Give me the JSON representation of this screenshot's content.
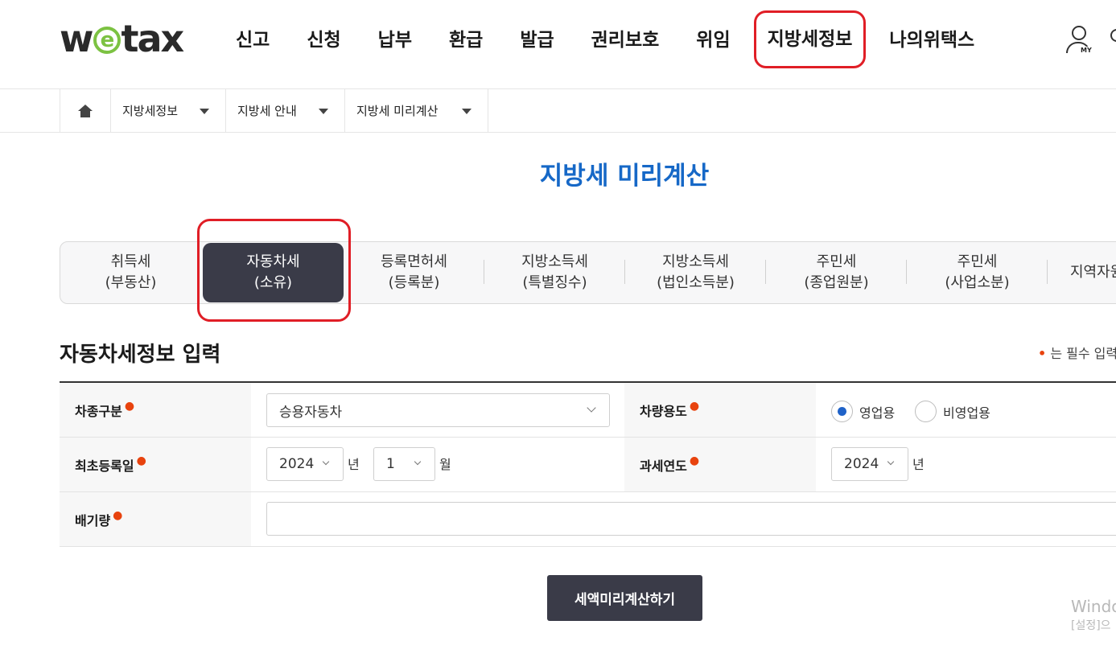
{
  "logo": {
    "text_pre": "w",
    "text_e": "e",
    "text_post": "tax"
  },
  "gnb": {
    "items": [
      "신고",
      "신청",
      "납부",
      "환급",
      "발급",
      "권리보호",
      "위임",
      "지방세정보",
      "나의위택스"
    ],
    "selected": "지방세정보",
    "my_label": "MY"
  },
  "breadcrumb": {
    "items": [
      "지방세정보",
      "지방세 안내",
      "지방세 미리계산"
    ]
  },
  "page_title": "지방세 미리계산",
  "tabs": [
    {
      "line1": "취득세",
      "line2": "(부동산)"
    },
    {
      "line1": "자동차세",
      "line2": "(소유)"
    },
    {
      "line1": "등록면허세",
      "line2": "(등록분)"
    },
    {
      "line1": "지방소득세",
      "line2": "(특별징수)"
    },
    {
      "line1": "지방소득세",
      "line2": "(법인소득분)"
    },
    {
      "line1": "주민세",
      "line2": "(종업원분)"
    },
    {
      "line1": "주민세",
      "line2": "(사업소분)"
    },
    {
      "line1": "지역자원",
      "line2": ""
    }
  ],
  "active_tab": "자동차세 (소유)",
  "section": {
    "title": "자동차세정보 입력",
    "required_note": "는 필수 입력"
  },
  "form": {
    "car_type_label": "차종구분",
    "car_type_value": "승용자동차",
    "usage_label": "차량용도",
    "usage_options": [
      "영업용",
      "비영업용"
    ],
    "usage_selected": "영업용",
    "first_reg_label": "최초등록일",
    "first_reg_year": "2024",
    "year_unit": "년",
    "first_reg_month": "1",
    "month_unit": "월",
    "tax_year_label": "과세연도",
    "tax_year_value": "2024",
    "displacement_label": "배기량",
    "displacement_value": ""
  },
  "submit_label": "세액미리계산하기",
  "watermark": {
    "line1": "Windo",
    "line2": "[설정]으"
  },
  "colors": {
    "accent_blue": "#1668c7",
    "dark_button": "#3a3b48",
    "required_dot": "#e8430e",
    "highlight_red": "#e01e26"
  }
}
